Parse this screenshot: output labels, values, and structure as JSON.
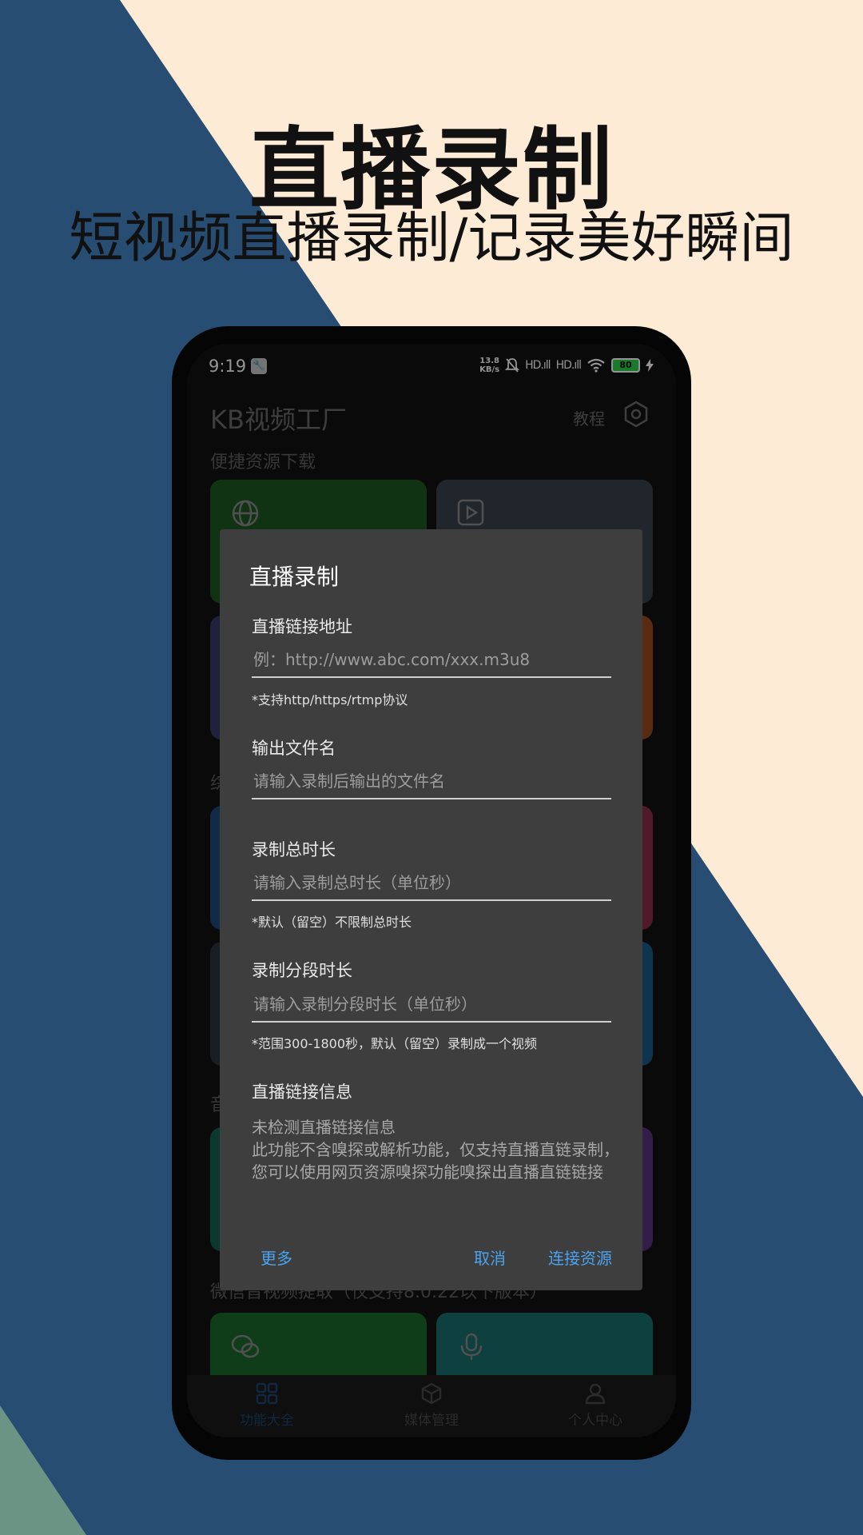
{
  "colors": {
    "bg_navy": "#284d72",
    "bg_cream": "#fdebd6",
    "bg_sage": "#6b9484",
    "accent_blue": "#4aa3ef",
    "dialog_bg": "#3e3e3e"
  },
  "hero": {
    "title": "直播录制",
    "subtitle": "短视频直播录制/记录美好瞬间"
  },
  "status_bar": {
    "time": "9:19",
    "speed_value": "13.8",
    "speed_unit": "KB/s",
    "signal1": "HD.ıll",
    "signal2": "HD.ıll",
    "battery": "80"
  },
  "app": {
    "title": "KB视频工厂",
    "tutorial_label": "教程",
    "section_quick_download": "便捷资源下载",
    "section_2_partial": "综",
    "section_3_partial": "音",
    "section_wechat": "微信音视频提取（仅支持8.0.22以下版本）",
    "icons": {
      "settings": "settings-icon",
      "tile_web": "globe-icon",
      "tile_video": "video-download-icon",
      "tile_wechat": "wechat-icon",
      "tile_audio": "microphone-icon"
    }
  },
  "dialog": {
    "title": "直播录制",
    "url_label": "直播链接地址",
    "url_placeholder": "例：http://www.abc.com/xxx.m3u8",
    "url_value": "",
    "url_hint": "*支持http/https/rtmp协议",
    "filename_label": "输出文件名",
    "filename_placeholder": "请输入录制后输出的文件名",
    "filename_value": "",
    "duration_label": "录制总时长",
    "duration_placeholder": "请输入录制总时长（单位秒）",
    "duration_value": "",
    "duration_hint": "*默认（留空）不限制总时长",
    "segment_label": "录制分段时长",
    "segment_placeholder": "请输入录制分段时长（单位秒）",
    "segment_value": "",
    "segment_hint": "*范围300-1800秒，默认（留空）录制成一个视频",
    "info_label": "直播链接信息",
    "info_line1": "未检测直播链接信息",
    "info_line2": "此功能不含嗅探或解析功能，仅支持直播直链录制，您可以使用网页资源嗅探功能嗅探出直播直链链接",
    "btn_more": "更多",
    "btn_cancel": "取消",
    "btn_connect": "连接资源"
  },
  "bottom_nav": {
    "items": [
      {
        "label": "功能大全",
        "icon": "grid-icon",
        "active": true
      },
      {
        "label": "媒体管理",
        "icon": "box-icon",
        "active": false
      },
      {
        "label": "个人中心",
        "icon": "user-icon",
        "active": false
      }
    ]
  }
}
